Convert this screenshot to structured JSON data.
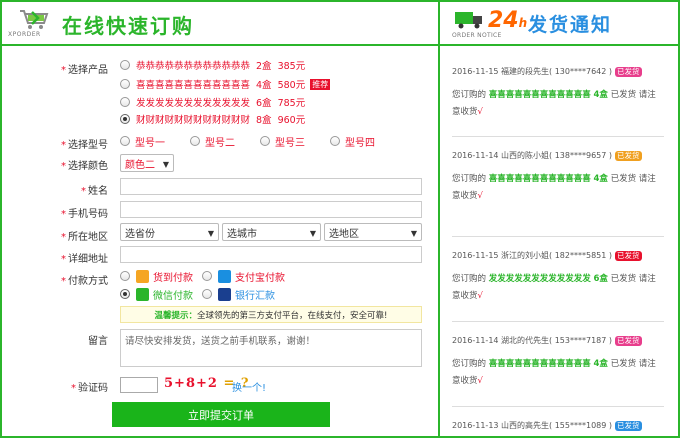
{
  "header_left": {
    "logo_text": "XPORDER",
    "title": "在线快速订购"
  },
  "header_right": {
    "logo_text": "ORDER NOTICE",
    "h24": "24",
    "h24_suffix": "h",
    "title": "发货通知"
  },
  "form": {
    "product_label": "选择产品",
    "products": [
      {
        "name": "恭恭恭恭恭恭恭恭恭恭恭恭",
        "qty": "2盒",
        "price": "385元",
        "badge": "",
        "checked": false
      },
      {
        "name": "喜喜喜喜喜喜喜喜喜喜喜喜",
        "qty": "4盒",
        "price": "580元",
        "badge": "推荐",
        "checked": false
      },
      {
        "name": "发发发发发发发发发发发发",
        "qty": "6盒",
        "price": "785元",
        "badge": "",
        "checked": false
      },
      {
        "name": "财财财财财财财财财财财财",
        "qty": "8盒",
        "price": "960元",
        "badge": "",
        "checked": true
      }
    ],
    "model_label": "选择型号",
    "models": [
      "型号一",
      "型号二",
      "型号三",
      "型号四"
    ],
    "color_label": "选择颜色",
    "color_value": "颜色二",
    "name_label": "姓名",
    "phone_label": "手机号码",
    "region_label": "所在地区",
    "province": "选省份",
    "city": "选城市",
    "district": "选地区",
    "address_label": "详细地址",
    "payment_label": "付款方式",
    "payments": [
      {
        "label": "货到付款",
        "color": "#e8112d",
        "icon_color": "#f5a623",
        "icon": "cash-on-delivery-icon",
        "checked": false
      },
      {
        "label": "支付宝付款",
        "color": "#e8112d",
        "icon_color": "#1a8fe0",
        "icon": "alipay-icon",
        "checked": false
      },
      {
        "label": "微信付款",
        "color": "#2bb52b",
        "icon_color": "#2bb52b",
        "icon": "wechat-icon",
        "checked": true
      },
      {
        "label": "银行汇款",
        "color": "#2a8fe0",
        "icon_color": "#1a3f8f",
        "icon": "unionpay-icon",
        "checked": false
      }
    ],
    "tip_title": "温馨提示：",
    "tip_text": "全球领先的第三方支付平台，在线支付，安全可靠!",
    "message_label": "留言",
    "message_value": "请尽快安排发货，送货之前手机联系，谢谢！",
    "captcha_label": "验证码",
    "captcha_expr": "5+8+2",
    "captcha_q": "= ?",
    "captcha_change": "换一个!",
    "submit_label": "立即提交订单"
  },
  "notices": [
    {
      "date": "2016-11-15",
      "location": "福建的段先生",
      "phone": "( 130****7642 )",
      "tag": "已发货",
      "tag_color": "#e83e8c",
      "prefix": "您订购的",
      "product": "喜喜喜喜喜喜喜喜喜喜喜喜",
      "qty": "4盒",
      "suffix": "已发货 请注意收货",
      "check": "√"
    },
    {
      "date": "2016-11-14",
      "location": "山西的陈小姐",
      "phone": "( 138****9657 )",
      "tag": "已发货",
      "tag_color": "#f0a020",
      "prefix": "您订购的",
      "product": "喜喜喜喜喜喜喜喜喜喜喜喜",
      "qty": "4盒",
      "suffix": "已发货 请注意收货",
      "check": "√"
    },
    {
      "date": "2016-11-15",
      "location": "浙江的刘小姐",
      "phone": "( 182****5851 )",
      "tag": "已发货",
      "tag_color": "#e8112d",
      "prefix": "您订购的",
      "product": "发发发发发发发发发发发发",
      "qty": "6盒",
      "suffix": "已发货 请注意收货",
      "check": "√"
    },
    {
      "date": "2016-11-14",
      "location": "湖北的代先生",
      "phone": "( 153****7187 )",
      "tag": "已发货",
      "tag_color": "#e83e8c",
      "prefix": "您订购的",
      "product": "喜喜喜喜喜喜喜喜喜喜喜喜",
      "qty": "4盒",
      "suffix": "已发货 请注意收货",
      "check": "√"
    },
    {
      "date": "2016-11-13",
      "location": "山西的高先生",
      "phone": "( 155****1089 )",
      "tag": "已发货",
      "tag_color": "#2a8fe0"
    }
  ]
}
